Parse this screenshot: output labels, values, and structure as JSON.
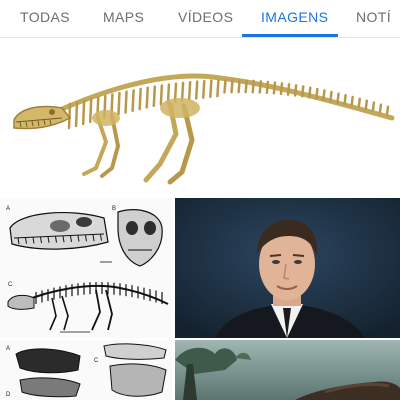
{
  "tabs": [
    {
      "label": "TODAS",
      "active": false
    },
    {
      "label": "MAPS",
      "active": false
    },
    {
      "label": "VÍDEOS",
      "active": false
    },
    {
      "label": "IMAGENS",
      "active": true
    },
    {
      "label": "NOTÍ",
      "active": false
    }
  ],
  "colors": {
    "accent": "#1a73e8",
    "inactive_tab": "#6e6e6e",
    "bone": "#c4a85a",
    "portrait_bg": "#1f3144"
  },
  "results": {
    "figure_labels": [
      "A",
      "B",
      "C",
      "A",
      "C",
      "D"
    ]
  }
}
